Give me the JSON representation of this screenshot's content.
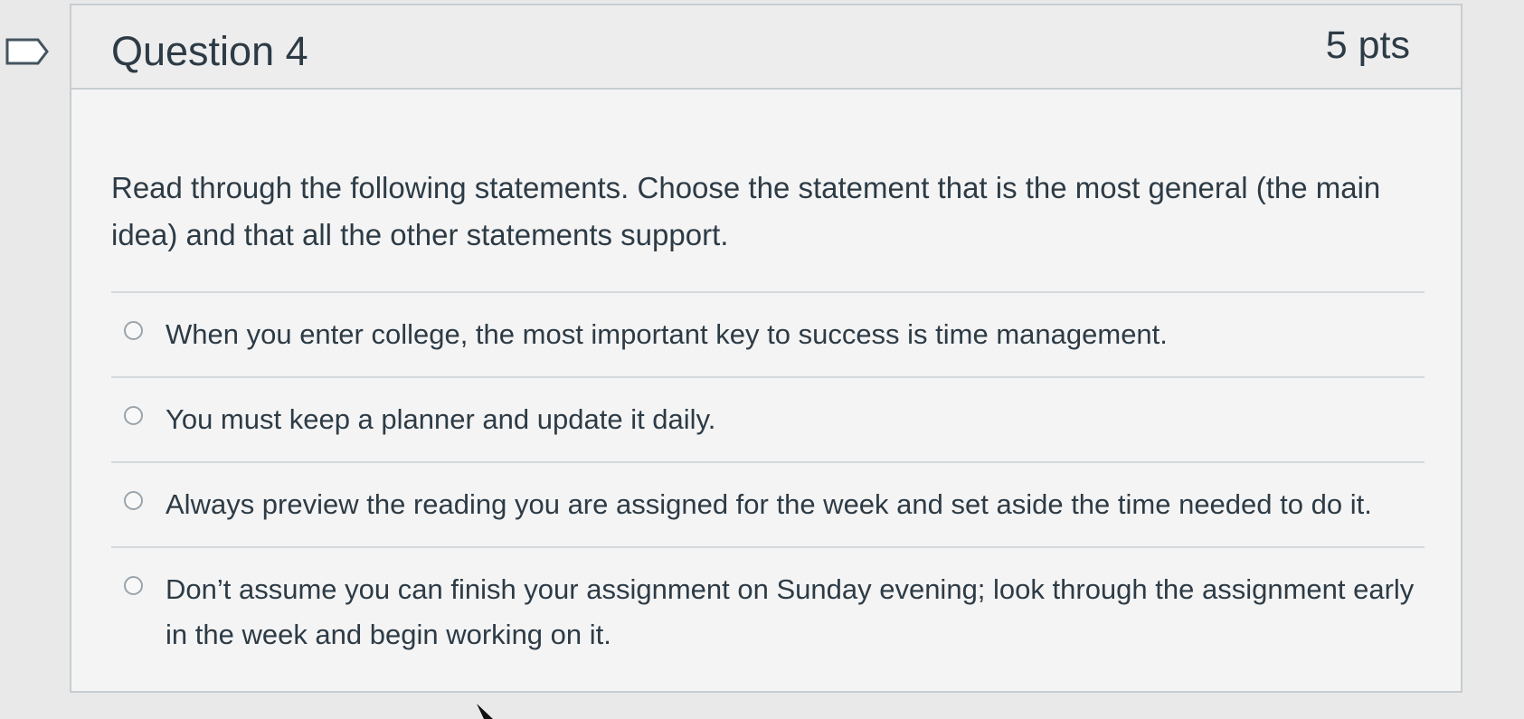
{
  "question": {
    "title": "Question 4",
    "points": "5 pts",
    "prompt": "Read through the following statements. Choose the statement that is the most general (the main idea) and that all the other statements support.",
    "answers": [
      {
        "label": "When you enter college, the most important key to success is time management."
      },
      {
        "label": "You must keep a planner and update it daily."
      },
      {
        "label": "Always preview the reading you are assigned for the week and set aside the time needed to do it."
      },
      {
        "label": "Don’t assume you can finish your assignment on Sunday evening; look through the assignment early in the week and begin working on it."
      }
    ]
  },
  "icons": {
    "flag": "flag-outline-icon",
    "cursor": "mouse-cursor-icon",
    "radio": "radio-button-icon"
  },
  "colors": {
    "text": "#2d3b45",
    "border": "#c7cdd1",
    "background": "#f4f4f5"
  }
}
